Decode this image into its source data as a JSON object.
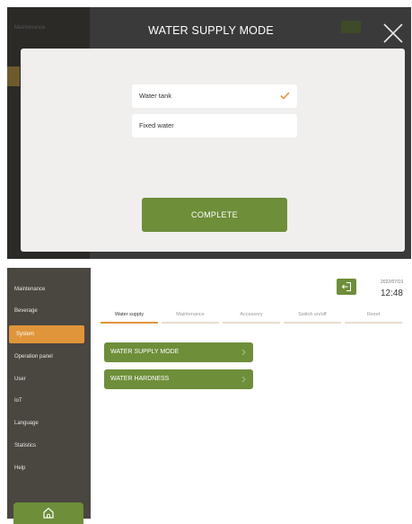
{
  "modal": {
    "title": "WATER SUPPLY MODE",
    "background_item": "Maintenance",
    "options": [
      {
        "label": "Water tank",
        "selected": true
      },
      {
        "label": "Fixed water",
        "selected": false
      }
    ],
    "complete_label": "COMPLETE"
  },
  "sidebar": {
    "items": [
      {
        "label": "Maintenance"
      },
      {
        "label": "Beverage"
      },
      {
        "label": "System",
        "active": true
      },
      {
        "label": "Operation panel"
      },
      {
        "label": "User"
      },
      {
        "label": "IoT"
      },
      {
        "label": "Language"
      },
      {
        "label": "Statistics"
      },
      {
        "label": "Help"
      }
    ],
    "home_icon": "home-icon"
  },
  "header": {
    "date": "2022/07/19",
    "time": "12:48",
    "exit_icon": "exit-icon"
  },
  "tabs": [
    {
      "label": "Water supply",
      "active": true
    },
    {
      "label": "Maintenance"
    },
    {
      "label": "Accessory"
    },
    {
      "label": "Switch on/off"
    },
    {
      "label": "Reset"
    }
  ],
  "menu": [
    {
      "label": "WATER SUPPLY MODE"
    },
    {
      "label": "WATER HARDNESS"
    }
  ],
  "colors": {
    "accent_green": "#6e8e3a",
    "accent_orange": "#e0953a",
    "sidebar_bg": "#4a4640",
    "modal_overlay": "#3a3a3a"
  }
}
